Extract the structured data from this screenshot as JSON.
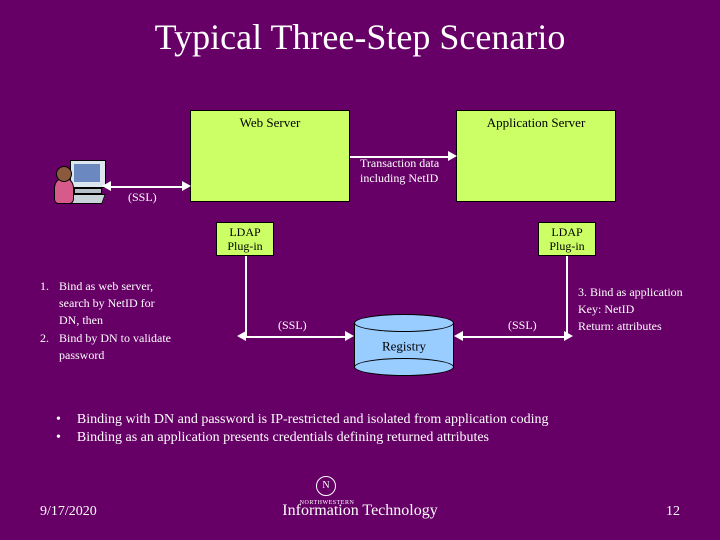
{
  "title": "Typical Three-Step Scenario",
  "boxes": {
    "web_server": "Web Server",
    "app_server": "Application Server"
  },
  "plug": {
    "left": "LDAP\nPlug-in",
    "right": "LDAP\nPlug-in"
  },
  "labels": {
    "ssl_left": "(SSL)",
    "transaction": "Transaction data\nincluding NetID",
    "ssl_mid": "(SSL)",
    "ssl_right": "(SSL)"
  },
  "registry": "Registry",
  "steps_left": {
    "n1": "1.",
    "t1": "Bind as web server,\nsearch by NetID for\nDN, then",
    "n2": "2.",
    "t2": "Bind by DN to validate\npassword"
  },
  "steps_right": "3. Bind as application\nKey: NetID\nReturn: attributes",
  "bullets": {
    "b1": "Binding with DN and password is IP-restricted and isolated from application coding",
    "b2": "Binding as an application presents credentials defining returned attributes"
  },
  "footer": {
    "date": "9/17/2020",
    "center": "Information Technology",
    "logo_label": "NORTHWESTERN",
    "page": "12"
  }
}
